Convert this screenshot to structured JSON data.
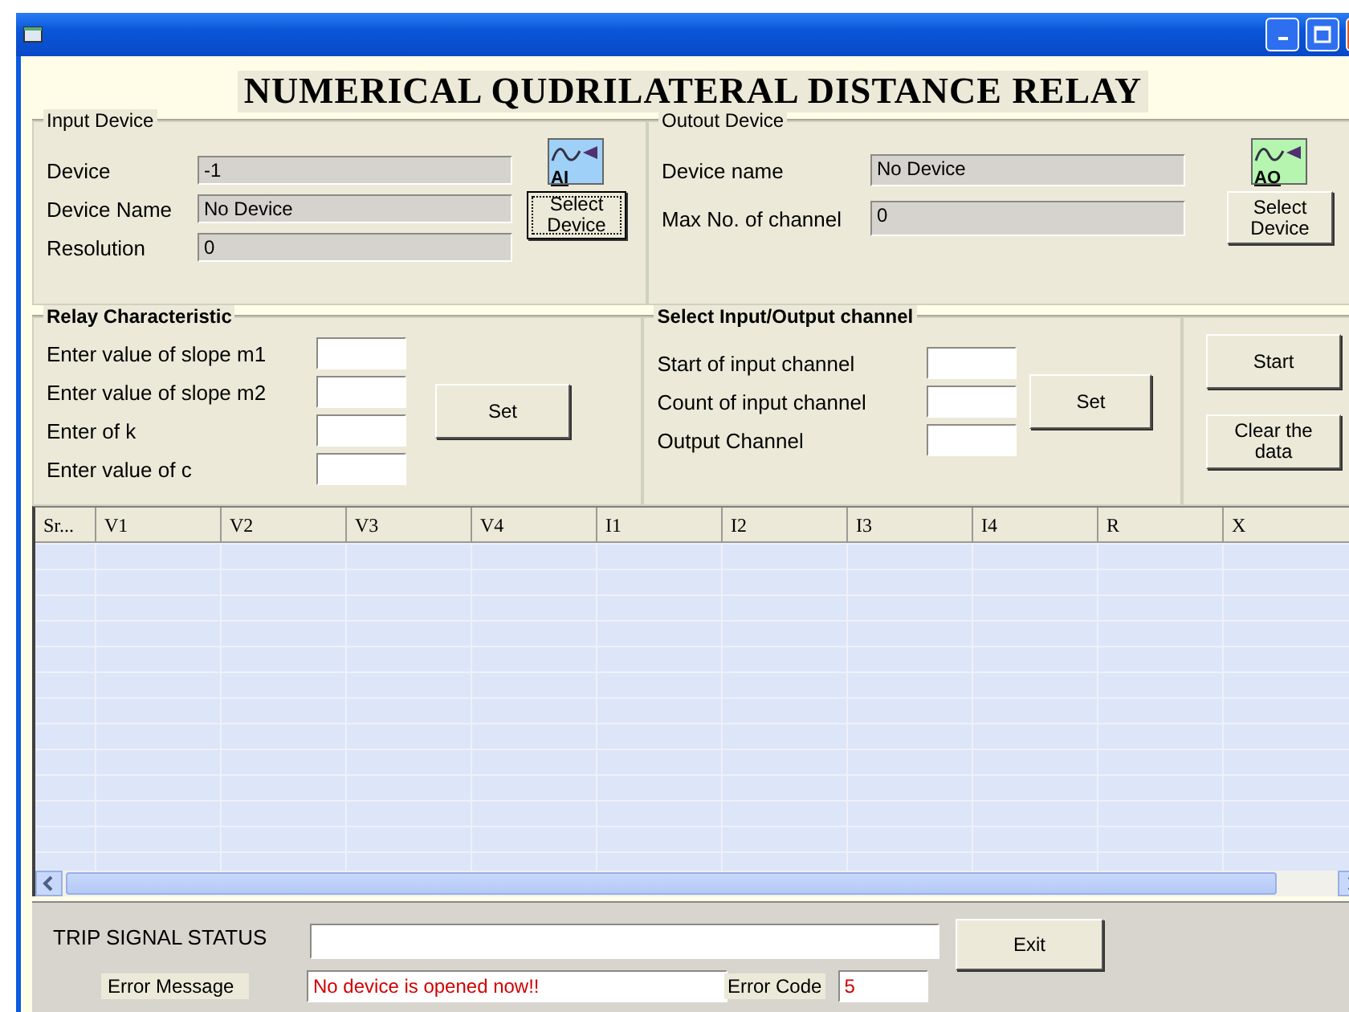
{
  "heading": "NUMERICAL QUDRILATERAL DISTANCE  RELAY",
  "input_device": {
    "title": "Input Device",
    "icon_label": "AI",
    "fields": [
      {
        "label": "Device",
        "value": "-1"
      },
      {
        "label": "Device Name",
        "value": "No Device"
      },
      {
        "label": "Resolution",
        "value": "0"
      }
    ],
    "button": "Select Device"
  },
  "output_device": {
    "title": "Outout Device",
    "icon_label": "AO",
    "fields": [
      {
        "label": "Device name",
        "value": "No Device"
      },
      {
        "label": "Max No. of channel",
        "value": "0"
      }
    ],
    "button": "Select Device"
  },
  "relay_characteristic": {
    "title": "Relay Characteristic",
    "fields": [
      {
        "label": "Enter value of slope m1"
      },
      {
        "label": "Enter value of slope m2"
      },
      {
        "label": "Enter of k"
      },
      {
        "label": "Enter value of c"
      }
    ],
    "button": "Set"
  },
  "io_channel": {
    "title": "Select Input/Output channel",
    "fields": [
      {
        "label": "Start of input channel"
      },
      {
        "label": "Count of input channel"
      },
      {
        "label": "Output Channel"
      }
    ],
    "button": "Set"
  },
  "actions": [
    "Start",
    "Clear the data"
  ],
  "table": {
    "columns": [
      "Sr...",
      "V1",
      "V2",
      "V3",
      "V4",
      "I1",
      "I2",
      "I3",
      "I4",
      "R",
      "X"
    ]
  },
  "status": {
    "trip_label": "TRIP SIGNAL STATUS",
    "error_message_label": "Error Message",
    "error_message": "No device is opened now!!",
    "error_code_label": "Error Code",
    "error_code": "5"
  },
  "exit_button": "Exit"
}
